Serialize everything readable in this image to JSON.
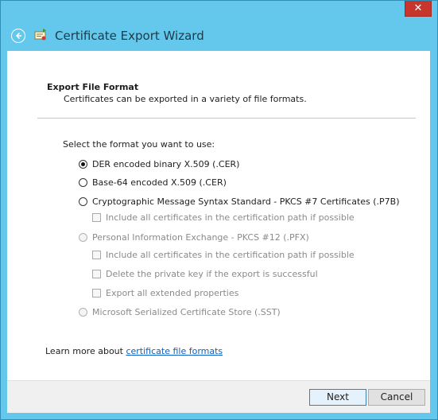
{
  "window": {
    "title": "Certificate Export Wizard",
    "close_glyph": "✕"
  },
  "section": {
    "title": "Export File Format",
    "description": "Certificates can be exported in a variety of file formats."
  },
  "format": {
    "prompt": "Select the format you want to use:",
    "options": [
      {
        "label": "DER encoded binary X.509 (.CER)",
        "checked": true,
        "enabled": true
      },
      {
        "label": "Base-64 encoded X.509 (.CER)",
        "checked": false,
        "enabled": true
      },
      {
        "label": "Cryptographic Message Syntax Standard - PKCS #7 Certificates (.P7B)",
        "checked": false,
        "enabled": true
      },
      {
        "label": "Personal Information Exchange - PKCS #12 (.PFX)",
        "checked": false,
        "enabled": false
      },
      {
        "label": "Microsoft Serialized Certificate Store (.SST)",
        "checked": false,
        "enabled": false
      }
    ],
    "p7b_checkboxes": [
      {
        "label": "Include all certificates in the certification path if possible",
        "checked": false,
        "enabled": false
      }
    ],
    "pfx_checkboxes": [
      {
        "label": "Include all certificates in the certification path if possible",
        "checked": false,
        "enabled": false
      },
      {
        "label": "Delete the private key if the export is successful",
        "checked": false,
        "enabled": false
      },
      {
        "label": "Export all extended properties",
        "checked": false,
        "enabled": false
      }
    ]
  },
  "learn_more": {
    "prefix": "Learn more about ",
    "link": "certificate file formats"
  },
  "buttons": {
    "next": "Next",
    "cancel": "Cancel"
  },
  "icons": {
    "back": "back-arrow-icon",
    "app": "certificate-icon"
  },
  "colors": {
    "title_bar": "#63c8ec",
    "close": "#c7352c",
    "link": "#0b5fc4"
  }
}
